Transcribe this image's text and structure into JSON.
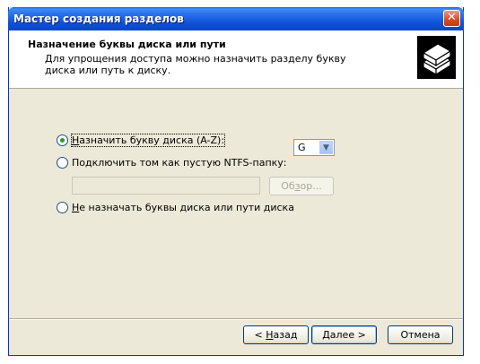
{
  "window": {
    "title": "Мастер создания разделов",
    "close_glyph": "✕"
  },
  "header": {
    "title": "Назначение буквы диска или пути",
    "description": "Для упрощения доступа можно назначить разделу букву диска или путь к диску.",
    "icon": "disk-stack-icon"
  },
  "options": {
    "assign_letter": {
      "prefix": "",
      "accel": "Н",
      "rest": "азначить букву диска (A-Z):",
      "checked": true
    },
    "mount_folder": {
      "prefix": "По",
      "accel": "д",
      "rest": "ключить том как пустую NTFS-папку:",
      "checked": false
    },
    "no_assign": {
      "prefix": "",
      "accel": "Н",
      "rest": "е назначать буквы диска или пути диска",
      "checked": false
    }
  },
  "drive_letter": {
    "value": "G",
    "arrow_glyph": "▼"
  },
  "path_input": {
    "value": ""
  },
  "browse": {
    "prefix": "Об",
    "accel": "з",
    "rest": "ор..."
  },
  "footer": {
    "back": {
      "prefix": "< ",
      "accel": "Н",
      "rest": "азад"
    },
    "next": {
      "prefix": "",
      "accel": "Д",
      "rest": "алее >"
    },
    "cancel": {
      "label": "Отмена"
    }
  }
}
